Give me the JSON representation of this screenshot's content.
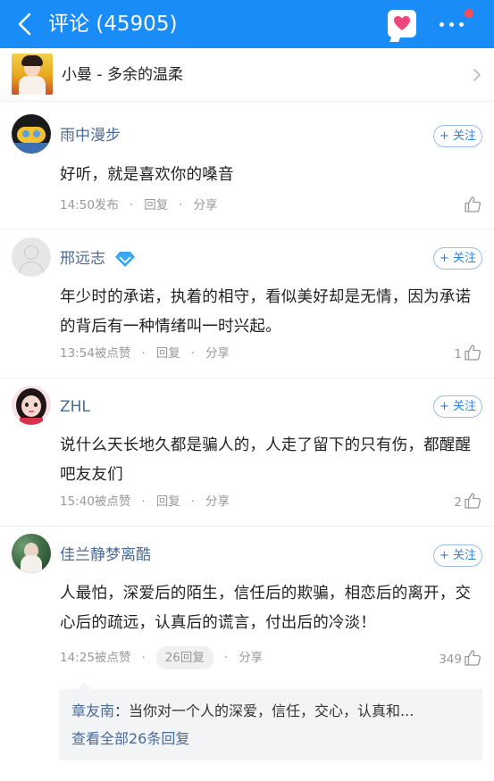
{
  "header": {
    "title": "评论 (45905)",
    "background": "#1a8cf7"
  },
  "song": {
    "title": "小曼 - 多余的温柔"
  },
  "follow_label": "+ 关注",
  "comments": [
    {
      "user": "雨中漫步",
      "text": "好听，就是喜欢你的嗓音",
      "time": "14:50发布",
      "reply": "回复",
      "share": "分享",
      "likes": ""
    },
    {
      "user": "邢远志",
      "text": "年少时的承诺，执着的相守，看似美好却是无情，因为承诺的背后有一种情绪叫一时兴起。",
      "time": "13:54被点赞",
      "reply": "回复",
      "share": "分享",
      "likes": "1"
    },
    {
      "user": "ZHL",
      "text": "说什么天长地久都是骗人的，人走了留下的只有伤，都醒醒吧友友们",
      "time": "15:40被点赞",
      "reply": "回复",
      "share": "分享",
      "likes": "2"
    },
    {
      "user": "佳兰静梦离酷",
      "text": "人最怕，深爱后的陌生，信任后的欺骗，相恋后的离开，交心后的疏远，认真后的谎言，付出后的冷淡！",
      "time": "14:25被点赞",
      "reply": "26回复",
      "share": "分享",
      "likes": "349"
    }
  ],
  "sub_reply": {
    "author": "章友南",
    "text": "：当你对一个人的深爱，信任，交心，认真和...",
    "view_all": "查看全部26条回复"
  }
}
